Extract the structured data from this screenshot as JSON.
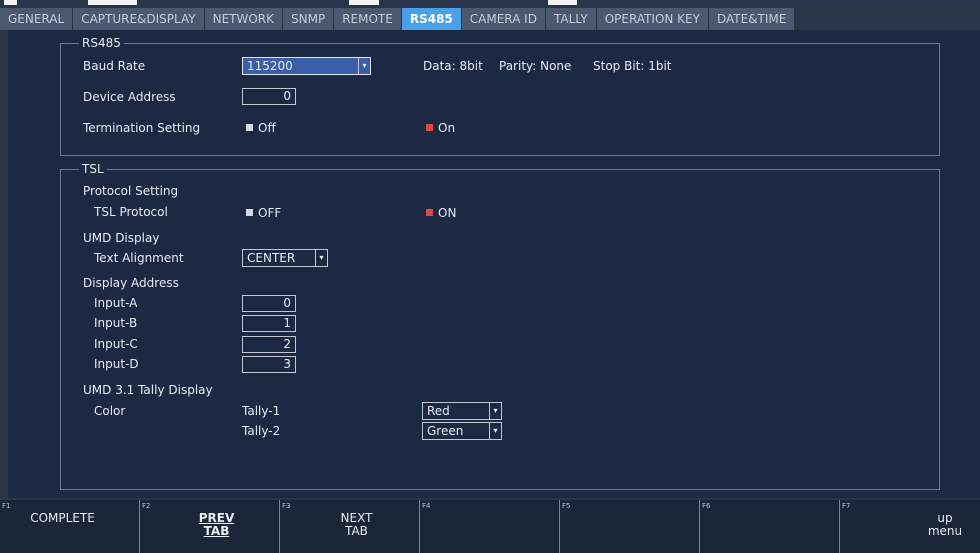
{
  "tabs": [
    "GENERAL",
    "CAPTURE&DISPLAY",
    "NETWORK",
    "SNMP",
    "REMOTE",
    "RS485",
    "CAMERA ID",
    "TALLY",
    "OPERATION KEY",
    "DATE&TIME"
  ],
  "active_tab": "RS485",
  "rs485": {
    "title": "RS485",
    "baud_rate_label": "Baud Rate",
    "baud_rate_value": "115200",
    "data_info": "Data: 8bit",
    "parity_info": "Parity: None",
    "stopbit_info": "Stop Bit: 1bit",
    "device_address_label": "Device Address",
    "device_address_value": "0",
    "termination_label": "Termination Setting",
    "termination_off": "Off",
    "termination_on": "On"
  },
  "tsl": {
    "title": "TSL",
    "protocol_setting_label": "Protocol Setting",
    "tsl_protocol_label": "TSL Protocol",
    "tsl_off": "OFF",
    "tsl_on": "ON",
    "umd_display_label": "UMD Display",
    "text_alignment_label": "Text Alignment",
    "text_alignment_value": "CENTER",
    "display_address_label": "Display Address",
    "inputs": [
      {
        "label": "Input-A",
        "value": "0"
      },
      {
        "label": "Input-B",
        "value": "1"
      },
      {
        "label": "Input-C",
        "value": "2"
      },
      {
        "label": "Input-D",
        "value": "3"
      }
    ],
    "tally_display_label": "UMD 3.1 Tally Display",
    "color_label": "Color",
    "tally1_label": "Tally-1",
    "tally1_value": "Red",
    "tally2_label": "Tally-2",
    "tally2_value": "Green"
  },
  "fkeys": [
    {
      "num": "F1",
      "label": "COMPLETE"
    },
    {
      "num": "F2",
      "label1": "PREV",
      "label2": "TAB"
    },
    {
      "num": "F3",
      "label1": "NEXT",
      "label2": "TAB"
    },
    {
      "num": "F4",
      "label": ""
    },
    {
      "num": "F5",
      "label": ""
    },
    {
      "num": "F6",
      "label": ""
    },
    {
      "num": "F7",
      "label1": "up",
      "label2": "menu"
    }
  ],
  "icons": {
    "dropdown_arrow": "chevron-down-icon",
    "checkbox": "checkbox-icon"
  },
  "colors": {
    "active_tab": "#4aa0e8",
    "selected_radio": "#e04848",
    "panel_bg": "#1c2942"
  }
}
